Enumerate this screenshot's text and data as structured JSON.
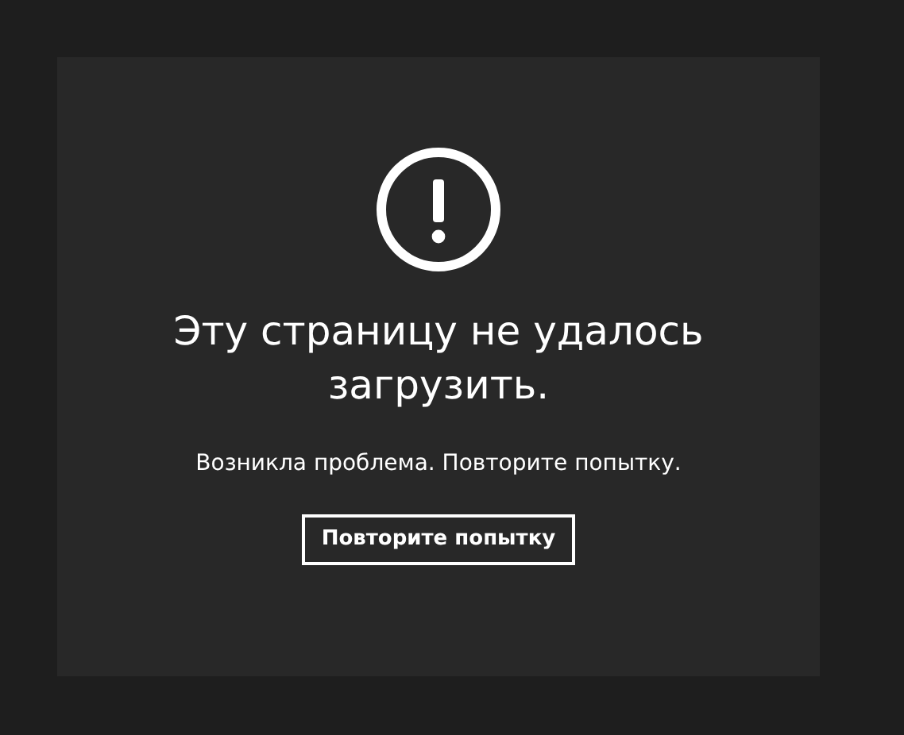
{
  "error": {
    "title": "Эту страницу не удалось загрузить.",
    "message": "Возникла проблема. Повторите попытку.",
    "button": "Повторите попытку"
  }
}
